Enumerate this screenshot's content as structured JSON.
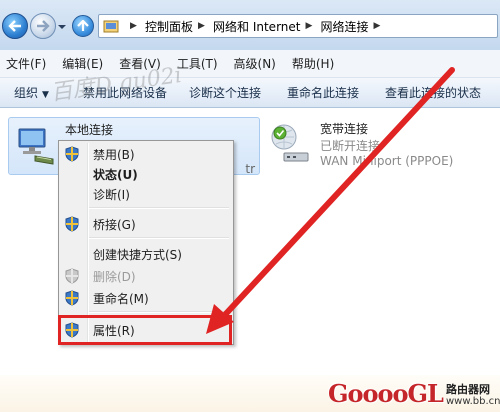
{
  "address_bar": {
    "crumbs": [
      "控制面板",
      "网络和 Internet",
      "网络连接"
    ]
  },
  "menu": {
    "items": [
      "文件(F)",
      "编辑(E)",
      "查看(V)",
      "工具(T)",
      "高级(N)",
      "帮助(H)"
    ]
  },
  "toolbar": {
    "organize": "组织",
    "disable": "禁用此网络设备",
    "diagnose": "诊断这个连接",
    "rename": "重命名此连接",
    "view_status": "查看此连接的状态"
  },
  "connections": {
    "local": {
      "name": "本地连接",
      "partial_text": "tr"
    },
    "broadband": {
      "name": "宽带连接",
      "status": "已断开连接",
      "device": "WAN Miniport (PPPOE)"
    }
  },
  "context_menu": {
    "items": [
      {
        "label": "禁用(B)"
      },
      {
        "label": "状态(U)"
      },
      {
        "label": "诊断(I)"
      },
      {
        "label": "桥接(G)"
      },
      {
        "label": "创建快捷方式(S)"
      },
      {
        "label": "删除(D)"
      },
      {
        "label": "重命名(M)"
      },
      {
        "label": "属性(R)"
      }
    ]
  },
  "watermark": "百度D  gu02i",
  "logo": {
    "brand": "GooooGL",
    "name": "路由器网",
    "domain": "www.bb.cn"
  },
  "colors": {
    "highlight": "#e02323",
    "arrow": "#e02323",
    "selection": "#d4e6fa"
  }
}
